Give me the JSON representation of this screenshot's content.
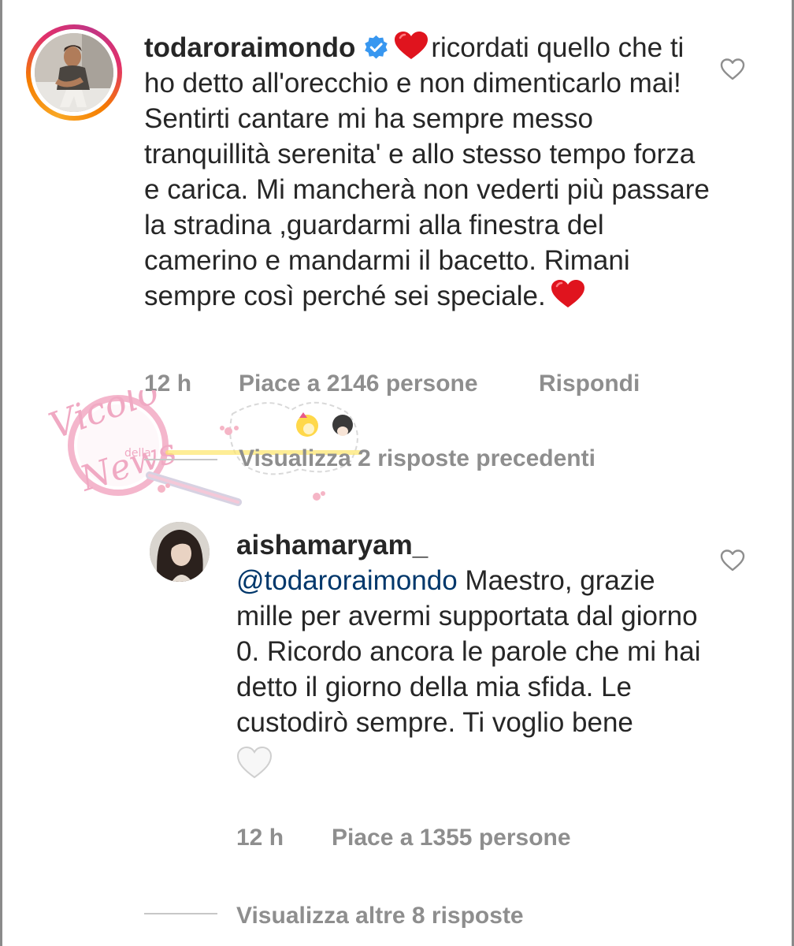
{
  "comment": {
    "username": "todaroraimondo",
    "text": "ricordati quello che ti ho detto all'orecchio e non dimenticarlo mai! Sentirti cantare mi ha sempre messo tranquillità serenita' e allo stesso tempo forza e carica. Mi mancherà non vederti più passare la stradina ,guardarmi alla finestra del camerino e mandarmi il bacetto. Rimani sempre così perché sei speciale.",
    "time": "12 h",
    "likes": "Piace a 2146 persone",
    "reply_label": "Rispondi",
    "icons": [
      "verified-badge-icon",
      "red-heart-emoji",
      "heart-outline-icon"
    ]
  },
  "view_previous_replies": "Visualizza 2 risposte precedenti",
  "watermark": {
    "line1": "Vicolo",
    "line2": "della",
    "line3": "News"
  },
  "reply": {
    "username": "aishamaryam_",
    "mention": "@todaroraimondo",
    "text": "Maestro, grazie mille per avermi supportata dal giorno 0. Ricordo ancora le parole che mi hai detto il giorno della mia sfida. Le custodirò sempre. Ti voglio bene",
    "time": "12 h",
    "likes": "Piace a 1355 persone",
    "icons": [
      "white-heart-emoji",
      "heart-outline-icon"
    ]
  },
  "view_more_replies": "Visualizza altre 8 risposte",
  "colors": {
    "text": "#262626",
    "secondary": "#8e8e8e",
    "mention": "#00376b",
    "verified": "#3897f0",
    "heart_red": "#e0141e"
  }
}
